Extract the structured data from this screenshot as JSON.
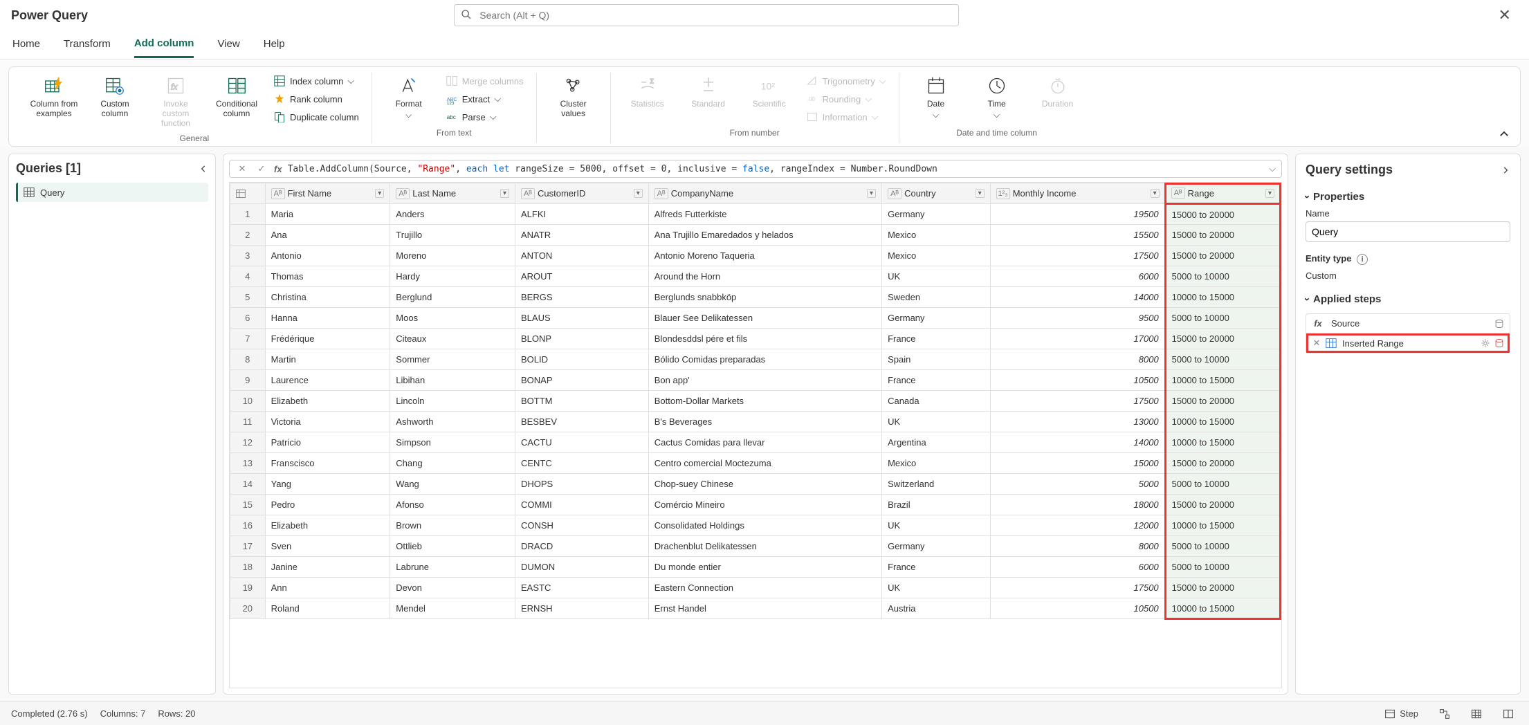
{
  "app_title": "Power Query",
  "search_placeholder": "Search (Alt + Q)",
  "tabs": {
    "home": "Home",
    "transform": "Transform",
    "add_column": "Add column",
    "view": "View",
    "help": "Help"
  },
  "ribbon": {
    "general": {
      "label": "General",
      "column_from_examples": "Column from examples",
      "custom_column": "Custom column",
      "invoke_custom_function": "Invoke custom function",
      "conditional_column": "Conditional column",
      "index_column": "Index column",
      "rank_column": "Rank column",
      "duplicate_column": "Duplicate column"
    },
    "from_text": {
      "label": "From text",
      "format": "Format",
      "merge_columns": "Merge columns",
      "extract": "Extract",
      "parse": "Parse"
    },
    "cluster": {
      "cluster_values": "Cluster values"
    },
    "from_number": {
      "label": "From number",
      "statistics": "Statistics",
      "standard": "Standard",
      "scientific": "Scientific",
      "trigonometry": "Trigonometry",
      "rounding": "Rounding",
      "information": "Information"
    },
    "date_time": {
      "label": "Date and time column",
      "date": "Date",
      "time": "Time",
      "duration": "Duration"
    }
  },
  "queries_panel": {
    "title": "Queries [1]",
    "items": [
      "Query"
    ]
  },
  "formula": {
    "prefix": "Table.AddColumn(Source, ",
    "range_str": "\"Range\"",
    "mid": ", ",
    "each_kw": "each let",
    "rest": " rangeSize = 5000, offset = 0, inclusive = ",
    "false_kw": "false",
    "rest2": ", rangeIndex = Number.RoundDown"
  },
  "columns": [
    "First Name",
    "Last Name",
    "CustomerID",
    "CompanyName",
    "Country",
    "Monthly Income",
    "Range"
  ],
  "col_types": [
    "ABC",
    "ABC",
    "ABC",
    "ABC",
    "ABC",
    "123",
    "ABC"
  ],
  "rows": [
    {
      "n": 1,
      "first": "Maria",
      "last": "Anders",
      "cid": "ALFKI",
      "company": "Alfreds Futterkiste",
      "country": "Germany",
      "income": 19500,
      "range": "15000 to 20000"
    },
    {
      "n": 2,
      "first": "Ana",
      "last": "Trujillo",
      "cid": "ANATR",
      "company": "Ana Trujillo Emaredados y helados",
      "country": "Mexico",
      "income": 15500,
      "range": "15000 to 20000"
    },
    {
      "n": 3,
      "first": "Antonio",
      "last": "Moreno",
      "cid": "ANTON",
      "company": "Antonio Moreno Taqueria",
      "country": "Mexico",
      "income": 17500,
      "range": "15000 to 20000"
    },
    {
      "n": 4,
      "first": "Thomas",
      "last": "Hardy",
      "cid": "AROUT",
      "company": "Around the Horn",
      "country": "UK",
      "income": 6000,
      "range": "5000 to 10000"
    },
    {
      "n": 5,
      "first": "Christina",
      "last": "Berglund",
      "cid": "BERGS",
      "company": "Berglunds snabbköp",
      "country": "Sweden",
      "income": 14000,
      "range": "10000 to 15000"
    },
    {
      "n": 6,
      "first": "Hanna",
      "last": "Moos",
      "cid": "BLAUS",
      "company": "Blauer See Delikatessen",
      "country": "Germany",
      "income": 9500,
      "range": "5000 to 10000"
    },
    {
      "n": 7,
      "first": "Frédérique",
      "last": "Citeaux",
      "cid": "BLONP",
      "company": "Blondesddsl pére et fils",
      "country": "France",
      "income": 17000,
      "range": "15000 to 20000"
    },
    {
      "n": 8,
      "first": "Martin",
      "last": "Sommer",
      "cid": "BOLID",
      "company": "Bólido Comidas preparadas",
      "country": "Spain",
      "income": 8000,
      "range": "5000 to 10000"
    },
    {
      "n": 9,
      "first": "Laurence",
      "last": "Libihan",
      "cid": "BONAP",
      "company": "Bon app'",
      "country": "France",
      "income": 10500,
      "range": "10000 to 15000"
    },
    {
      "n": 10,
      "first": "Elizabeth",
      "last": "Lincoln",
      "cid": "BOTTM",
      "company": "Bottom-Dollar Markets",
      "country": "Canada",
      "income": 17500,
      "range": "15000 to 20000"
    },
    {
      "n": 11,
      "first": "Victoria",
      "last": "Ashworth",
      "cid": "BESBEV",
      "company": "B's Beverages",
      "country": "UK",
      "income": 13000,
      "range": "10000 to 15000"
    },
    {
      "n": 12,
      "first": "Patricio",
      "last": "Simpson",
      "cid": "CACTU",
      "company": "Cactus Comidas para llevar",
      "country": "Argentina",
      "income": 14000,
      "range": "10000 to 15000"
    },
    {
      "n": 13,
      "first": "Franscisco",
      "last": "Chang",
      "cid": "CENTC",
      "company": "Centro comercial Moctezuma",
      "country": "Mexico",
      "income": 15000,
      "range": "15000 to 20000"
    },
    {
      "n": 14,
      "first": "Yang",
      "last": "Wang",
      "cid": "DHOPS",
      "company": "Chop-suey Chinese",
      "country": "Switzerland",
      "income": 5000,
      "range": "5000 to 10000"
    },
    {
      "n": 15,
      "first": "Pedro",
      "last": "Afonso",
      "cid": "COMMI",
      "company": "Comércio Mineiro",
      "country": "Brazil",
      "income": 18000,
      "range": "15000 to 20000"
    },
    {
      "n": 16,
      "first": "Elizabeth",
      "last": "Brown",
      "cid": "CONSH",
      "company": "Consolidated Holdings",
      "country": "UK",
      "income": 12000,
      "range": "10000 to 15000"
    },
    {
      "n": 17,
      "first": "Sven",
      "last": "Ottlieb",
      "cid": "DRACD",
      "company": "Drachenblut Delikatessen",
      "country": "Germany",
      "income": 8000,
      "range": "5000 to 10000"
    },
    {
      "n": 18,
      "first": "Janine",
      "last": "Labrune",
      "cid": "DUMON",
      "company": "Du monde entier",
      "country": "France",
      "income": 6000,
      "range": "5000 to 10000"
    },
    {
      "n": 19,
      "first": "Ann",
      "last": "Devon",
      "cid": "EASTC",
      "company": "Eastern Connection",
      "country": "UK",
      "income": 17500,
      "range": "15000 to 20000"
    },
    {
      "n": 20,
      "first": "Roland",
      "last": "Mendel",
      "cid": "ERNSH",
      "company": "Ernst Handel",
      "country": "Austria",
      "income": 10500,
      "range": "10000 to 15000"
    }
  ],
  "settings": {
    "title": "Query settings",
    "properties": "Properties",
    "name_label": "Name",
    "name_value": "Query",
    "entity_type_label": "Entity type",
    "entity_type_value": "Custom",
    "applied_steps": "Applied steps",
    "steps": [
      {
        "label": "Source",
        "fx": true
      },
      {
        "label": "Inserted Range",
        "fx": false
      }
    ]
  },
  "status": {
    "completed": "Completed (2.76 s)",
    "columns": "Columns: 7",
    "rows": "Rows: 20",
    "step_btn": "Step"
  }
}
